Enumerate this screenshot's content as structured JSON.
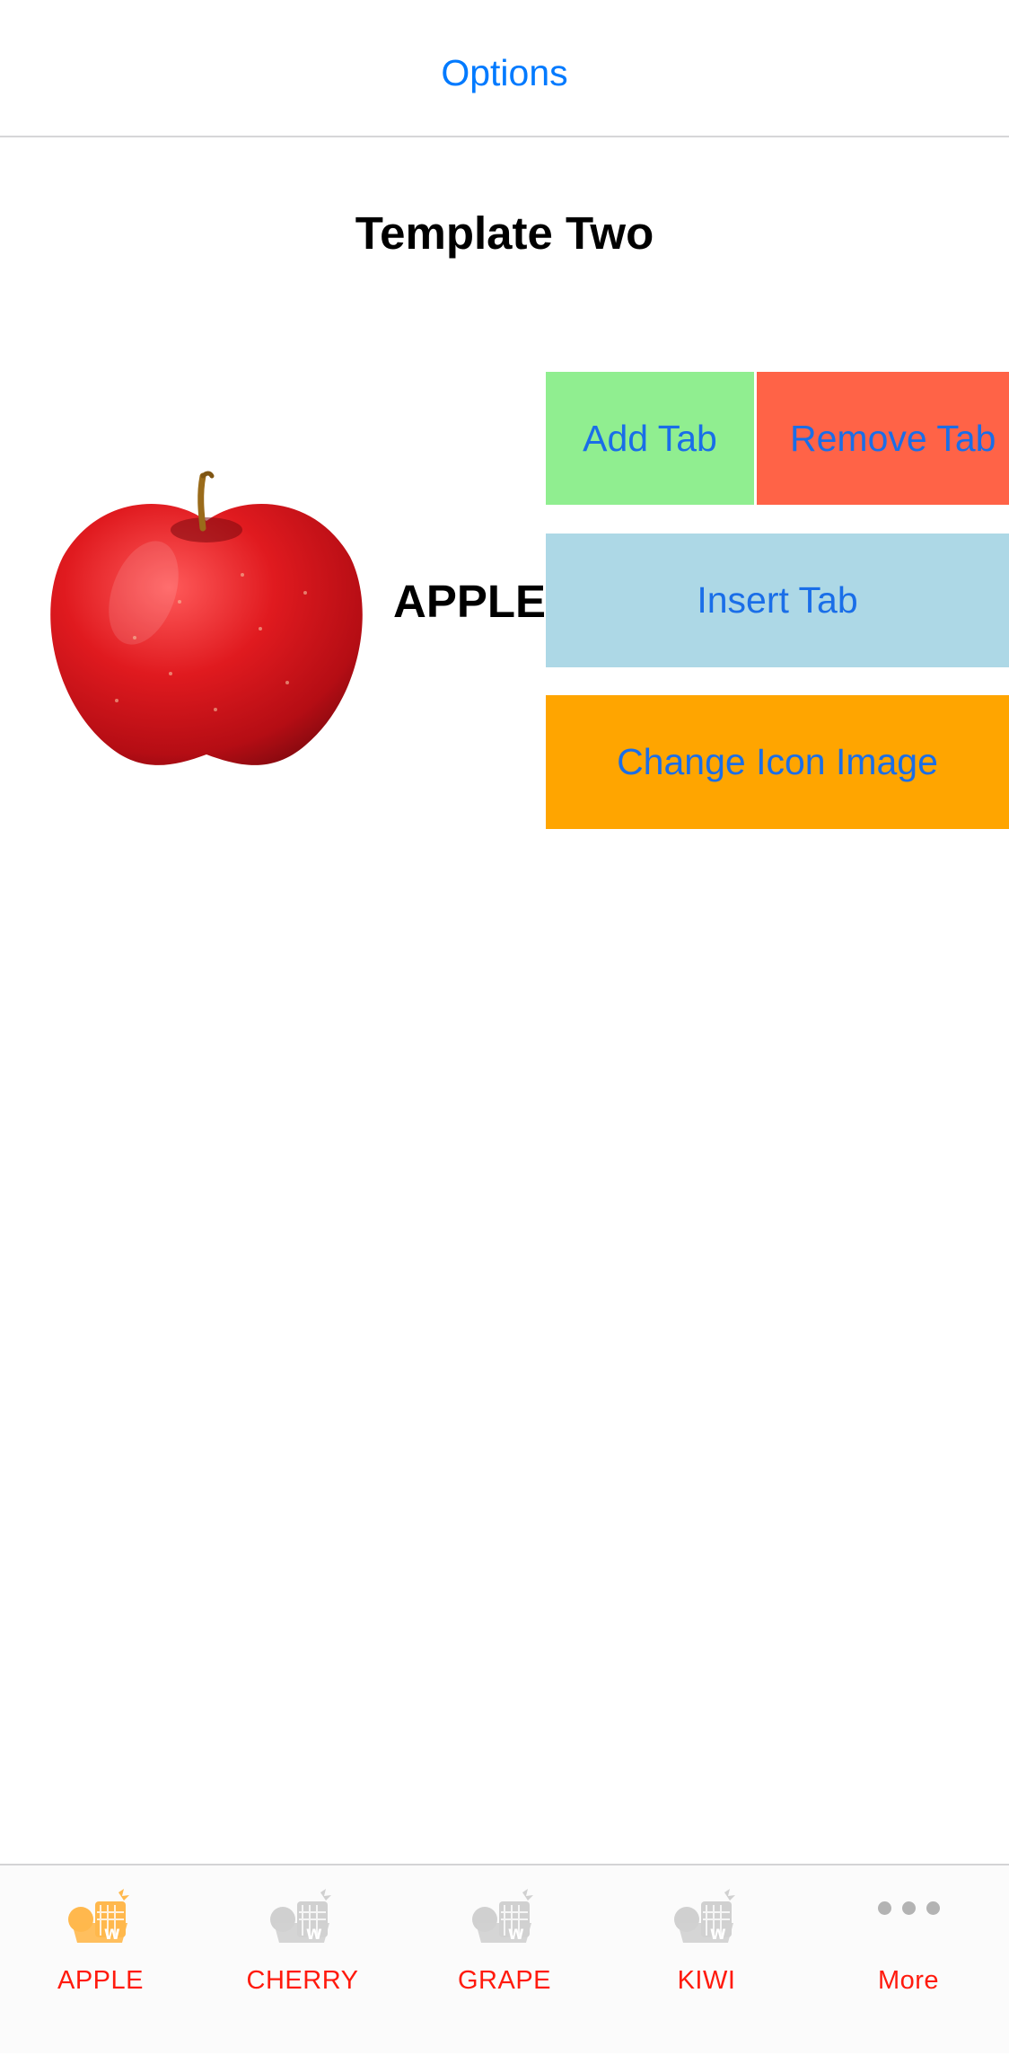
{
  "nav": {
    "options_label": "Options"
  },
  "page": {
    "title": "Template Two",
    "fruit_label": "APPLE",
    "image_alt": "Red apple"
  },
  "buttons": {
    "add_tab": "Add Tab",
    "remove_tab": "Remove Tab",
    "insert_tab": "Insert Tab",
    "change_icon": "Change Icon Image"
  },
  "button_colors": {
    "add_tab": "#90ee90",
    "remove_tab": "#ff6347",
    "insert_tab": "#add8e6",
    "change_icon": "#ffa500",
    "text": "#1a6ee8"
  },
  "tab_bar": {
    "items": [
      {
        "label": "APPLE",
        "icon": "fruit-basket-icon",
        "selected": true
      },
      {
        "label": "CHERRY",
        "icon": "fruit-basket-icon",
        "selected": false
      },
      {
        "label": "GRAPE",
        "icon": "fruit-basket-icon",
        "selected": false
      },
      {
        "label": "KIWI",
        "icon": "fruit-basket-icon",
        "selected": false
      },
      {
        "label": "More",
        "icon": "more-dots-icon",
        "selected": false
      }
    ],
    "label_color": "#ff1a0d",
    "selected_icon_color": "#ffb84d",
    "unselected_icon_color": "#d0d0d0"
  }
}
